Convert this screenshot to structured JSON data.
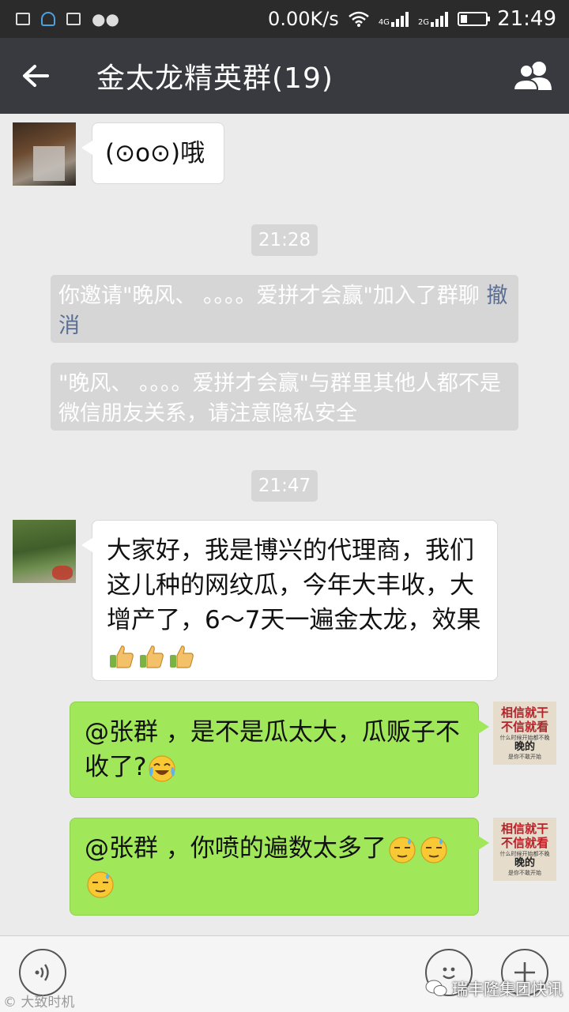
{
  "status_bar": {
    "network_speed": "0.00K/s",
    "signal_1_label": "4G",
    "signal_2_label": "2G",
    "time": "21:49",
    "battery_fraction": 0.25
  },
  "header": {
    "title": "金太龙精英群(19)",
    "back_icon": "arrow-left-icon",
    "group_icon": "group-members-icon"
  },
  "messages": [
    {
      "id": "m1",
      "side": "left",
      "text": "(⊙o⊙)哦"
    },
    {
      "id": "t1",
      "type": "time",
      "text": "21:28"
    },
    {
      "id": "s1",
      "type": "system",
      "text": "你邀请\"晚风、 。。。。爱拼才会赢\"加入了群聊",
      "action": "撤消"
    },
    {
      "id": "s2",
      "type": "system",
      "text": "\"晚风、 。。。。爱拼才会赢\"与群里其他人都不是微信朋友关系，请注意隐私安全"
    },
    {
      "id": "t2",
      "type": "time",
      "text": "21:47"
    },
    {
      "id": "m2",
      "side": "left",
      "text": "大家好，我是博兴的代理商，我们这儿种的网纹瓜，今年大丰收，大增产了，6～7天一遍金太龙，效果",
      "emoji": [
        "thumbs-up-icon",
        "thumbs-up-icon",
        "thumbs-up-icon"
      ]
    },
    {
      "id": "m3",
      "side": "right",
      "text": "@张群 ，是不是瓜太大，瓜贩子不收了?",
      "emoji": [
        "crying-laughing-icon"
      ]
    },
    {
      "id": "m4",
      "side": "right",
      "text": "@张群 ，你喷的遍数太多了",
      "emoji": [
        "sweat-face-icon",
        "sweat-face-icon",
        "sweat-face-icon"
      ]
    }
  ],
  "sticker_avatar": {
    "line1": "相信就干",
    "line2": "不信就看",
    "line3": "什么时候开始都不晚",
    "line4": "晚的",
    "line5": "是你不敢开始"
  },
  "watermarks": {
    "left": "大致时机",
    "right": "瑞丰隆集团快讯"
  },
  "colors": {
    "status_bar": "#2b2b2b",
    "title_bar": "#393a3f",
    "chat_bg": "#ebebeb",
    "own_bubble": "#a0e75a",
    "system_bg": "#d6d6d6",
    "revoke_link": "#5a6f95"
  }
}
